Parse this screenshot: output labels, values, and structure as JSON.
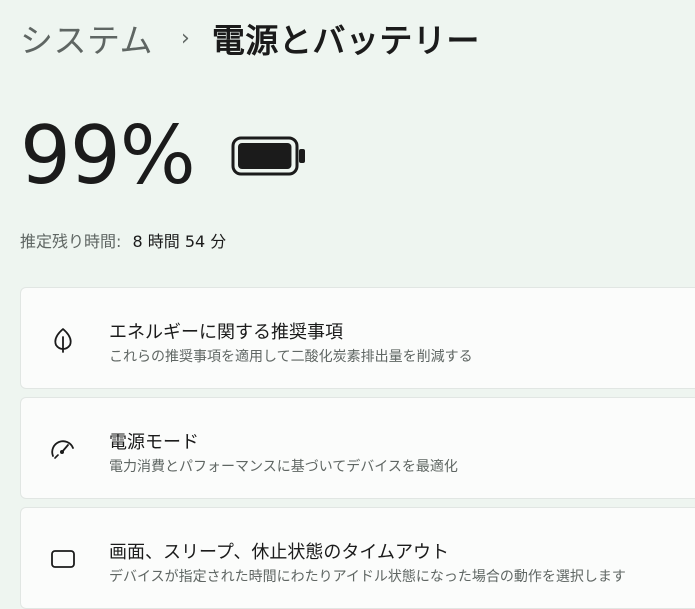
{
  "breadcrumb": {
    "parent": "システム",
    "separator": "›",
    "current": "電源とバッテリー"
  },
  "battery": {
    "percent_text": "99%",
    "level": 0.99,
    "icon": "battery-full-icon"
  },
  "remaining": {
    "label": "推定残り時間:",
    "value": "8 時間 54 分"
  },
  "cards": [
    {
      "icon": "leaf-icon",
      "title": "エネルギーに関する推奨事項",
      "description": "これらの推奨事項を適用して二酸化炭素排出量を削減する"
    },
    {
      "icon": "speedometer-icon",
      "title": "電源モード",
      "description": "電力消費とパフォーマンスに基づいてデバイスを最適化"
    },
    {
      "icon": "screen-sleep-icon",
      "title": "画面、スリープ、休止状態のタイムアウト",
      "description": "デバイスが指定された時間にわたりアイドル状態になった場合の動作を選択します"
    }
  ],
  "colors": {
    "background": "#eef5f0",
    "card": "#fbfcfb",
    "text_primary": "#1b1b1b",
    "text_secondary": "#5f6663"
  }
}
